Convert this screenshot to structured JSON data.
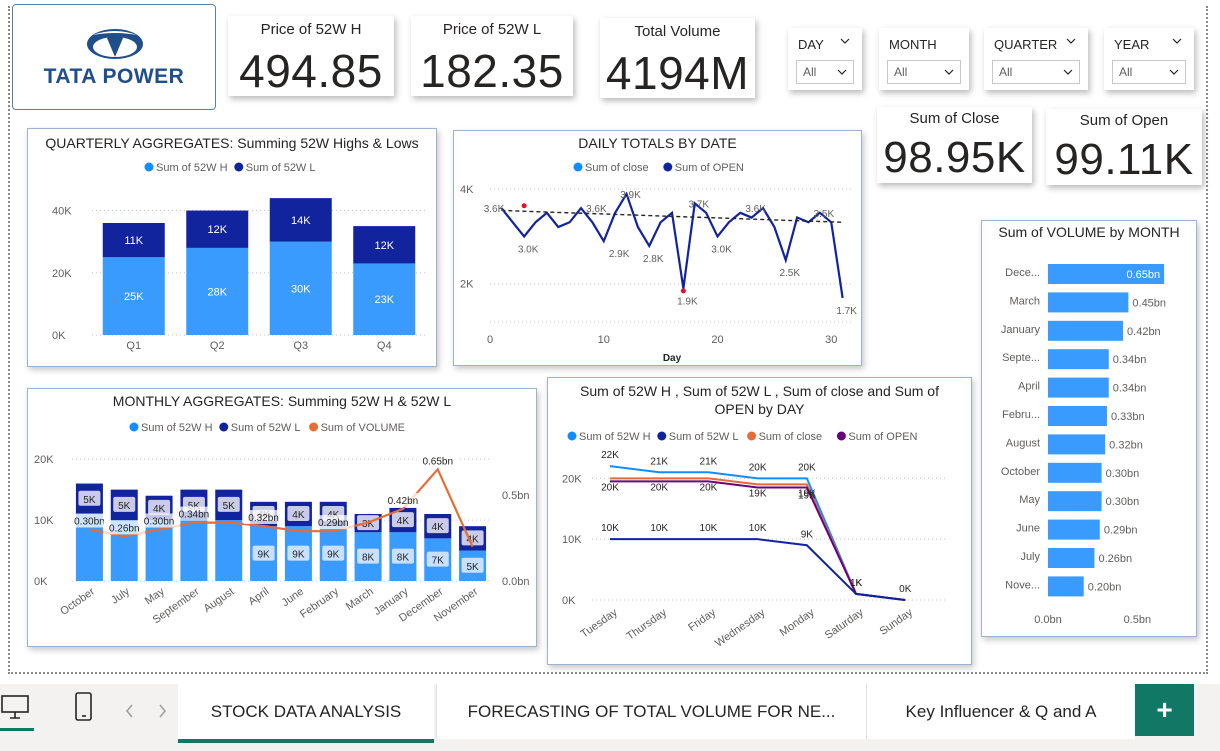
{
  "logo": {
    "text": "TATA POWER"
  },
  "kpis": {
    "high52": {
      "title": "Price of 52W H",
      "value": "494.85"
    },
    "low52": {
      "title": "Price of 52W L",
      "value": "182.35"
    },
    "volume": {
      "title": "Total Volume",
      "value": "4194M"
    },
    "close": {
      "title": "Sum of Close",
      "value": "98.95K"
    },
    "open": {
      "title": "Sum of Open",
      "value": "99.11K"
    }
  },
  "slicers": [
    {
      "title": "DAY",
      "value": "All"
    },
    {
      "title": "MONTH",
      "value": "All"
    },
    {
      "title": "QUARTER",
      "value": "All"
    },
    {
      "title": "YEAR",
      "value": "All"
    }
  ],
  "colors": {
    "light_blue": "#118dff",
    "dark_blue": "#12239e",
    "orange": "#e66c37",
    "purple": "#6b007b",
    "sky": "#3a9bff"
  },
  "chart_data": [
    {
      "id": "quarterly",
      "type": "bar",
      "stacked": true,
      "title": "QUARTERLY AGGREGATES: Summing 52W Highs & Lows",
      "categories": [
        "Q1",
        "Q2",
        "Q3",
        "Q4"
      ],
      "series": [
        {
          "name": "Sum of 52W H",
          "values": [
            25000,
            28000,
            30000,
            23000
          ],
          "labels": [
            "25K",
            "28K",
            "30K",
            "23K"
          ]
        },
        {
          "name": "Sum of 52W L",
          "values": [
            11000,
            12000,
            14000,
            12000
          ],
          "labels": [
            "11K",
            "12K",
            "14K",
            "12K"
          ]
        }
      ],
      "yticks": [
        "0K",
        "20K",
        "40K"
      ],
      "ylim": [
        0,
        45000
      ]
    },
    {
      "id": "daily",
      "type": "line",
      "title": "DAILY TOTALS BY DATE",
      "xlabel": "Day",
      "xticks": [
        "0",
        "10",
        "20",
        "30"
      ],
      "yticks": [
        "2K",
        "4K"
      ],
      "series": [
        {
          "name": "Sum of close",
          "values": []
        },
        {
          "name": "Sum of OPEN",
          "x": [
            1,
            2,
            3,
            4,
            5,
            6,
            7,
            8,
            9,
            10,
            11,
            12,
            13,
            14,
            15,
            16,
            17,
            18,
            19,
            20,
            21,
            22,
            23,
            24,
            25,
            26,
            27,
            28,
            29,
            30,
            31
          ],
          "values": [
            3600,
            3300,
            3000,
            3300,
            3500,
            3200,
            3300,
            3600,
            3300,
            2900,
            3500,
            3900,
            3200,
            2800,
            3300,
            3500,
            1900,
            3700,
            3500,
            3000,
            3300,
            3500,
            3400,
            3600,
            3200,
            2500,
            3400,
            3300,
            3500,
            3300,
            1700
          ]
        }
      ],
      "data_labels": [
        "3.6K",
        "3.0K",
        "3.6K",
        "3.9K",
        "2.9K",
        "2.8K",
        "1.9K",
        "3.7K",
        "3.0K",
        "3.6K",
        "2.5K",
        "3.5K",
        "1.7K"
      ]
    },
    {
      "id": "monthly",
      "type": "bar",
      "stacked": true,
      "title": "MONTHLY AGGREGATES: Summing 52W H & 52W L",
      "categories": [
        "October",
        "July",
        "May",
        "September",
        "August",
        "April",
        "June",
        "February",
        "March",
        "January",
        "December",
        "November"
      ],
      "series": [
        {
          "name": "Sum of 52W H",
          "values": [
            11000,
            10000,
            10000,
            10000,
            10000,
            9000,
            9000,
            9000,
            8000,
            8000,
            7000,
            5000
          ],
          "labels": [
            "",
            "",
            "",
            "",
            "",
            "9K",
            "9K",
            "9K",
            "8K",
            "8K",
            "7K",
            "5K"
          ]
        },
        {
          "name": "Sum of 52W L",
          "values": [
            5000,
            5000,
            4000,
            5000,
            5000,
            4000,
            4000,
            4000,
            3000,
            4000,
            4000,
            4000
          ],
          "labels": [
            "5K",
            "5K",
            "4K",
            "5K",
            "5K",
            "4K",
            "4K",
            "4K",
            "3K",
            "4K",
            "4K",
            "4K"
          ]
        },
        {
          "name": "Sum of VOLUME",
          "values": [
            0.3,
            0.26,
            0.3,
            0.34,
            0.34,
            0.32,
            0.29,
            0.29,
            0.34,
            0.42,
            0.65,
            0.2
          ],
          "labels": [
            "0.30bn",
            "0.26bn",
            "0.30bn",
            "0.34bn",
            "",
            "0.32bn",
            "",
            "0.29bn",
            "",
            "0.42bn",
            "0.65bn",
            ""
          ]
        }
      ],
      "yticks": [
        "0K",
        "10K",
        "20K"
      ],
      "y2ticks": [
        "0.0bn",
        "0.5bn"
      ],
      "ylim": [
        0,
        22000
      ],
      "y2lim": [
        0,
        0.78
      ]
    },
    {
      "id": "byday",
      "type": "line",
      "title": "Sum of 52W H , Sum of 52W L , Sum of close and Sum of OPEN by DAY",
      "categories": [
        "Tuesday",
        "Thursday",
        "Friday",
        "Wednesday",
        "Monday",
        "Saturday",
        "Sunday"
      ],
      "series": [
        {
          "name": "Sum of 52W H",
          "values": [
            22000,
            21000,
            21000,
            20000,
            20000,
            1000,
            0
          ],
          "labels": [
            "22K",
            "21K",
            "21K",
            "20K",
            "20K",
            "1K",
            "0K"
          ]
        },
        {
          "name": "Sum of 52W L",
          "values": [
            10000,
            10000,
            10000,
            10000,
            9000,
            1000,
            0
          ],
          "labels": [
            "10K",
            "10K",
            "10K",
            "10K",
            "9K",
            "1K",
            ""
          ]
        },
        {
          "name": "Sum of close",
          "values": [
            20000,
            20000,
            20000,
            19000,
            19000,
            1000,
            0
          ],
          "labels": [
            "20K",
            "20K",
            "20K",
            "19K",
            "19K",
            "",
            ""
          ]
        },
        {
          "name": "Sum of OPEN",
          "values": [
            20000,
            20000,
            20000,
            19000,
            19000,
            1000,
            0
          ],
          "labels": [
            "",
            "",
            "",
            "",
            "19K",
            "",
            ""
          ]
        }
      ],
      "yticks": [
        "0K",
        "10K",
        "20K"
      ],
      "ylim": [
        0,
        24000
      ]
    },
    {
      "id": "volmonth",
      "type": "bar",
      "orientation": "horizontal",
      "title": "Sum of VOLUME by MONTH",
      "categories": [
        "Dece...",
        "March",
        "January",
        "Septe...",
        "April",
        "Febru...",
        "August",
        "October",
        "May",
        "June",
        "July",
        "Nove..."
      ],
      "values": [
        0.65,
        0.45,
        0.42,
        0.34,
        0.34,
        0.33,
        0.32,
        0.3,
        0.3,
        0.29,
        0.26,
        0.2
      ],
      "labels": [
        "0.65bn",
        "0.45bn",
        "0.42bn",
        "0.34bn",
        "0.34bn",
        "0.33bn",
        "0.32bn",
        "0.30bn",
        "0.30bn",
        "0.29bn",
        "0.26bn",
        "0.20bn"
      ],
      "xticks": [
        "0.0bn",
        "0.5bn"
      ],
      "xlim": [
        0,
        0.75
      ]
    }
  ],
  "tabs": [
    {
      "label": "STOCK DATA ANALYSIS",
      "active": true
    },
    {
      "label": "FORECASTING OF TOTAL VOLUME FOR NE...",
      "active": false
    },
    {
      "label": "Key Influencer & Q and A",
      "active": false
    }
  ],
  "add_page": "+"
}
